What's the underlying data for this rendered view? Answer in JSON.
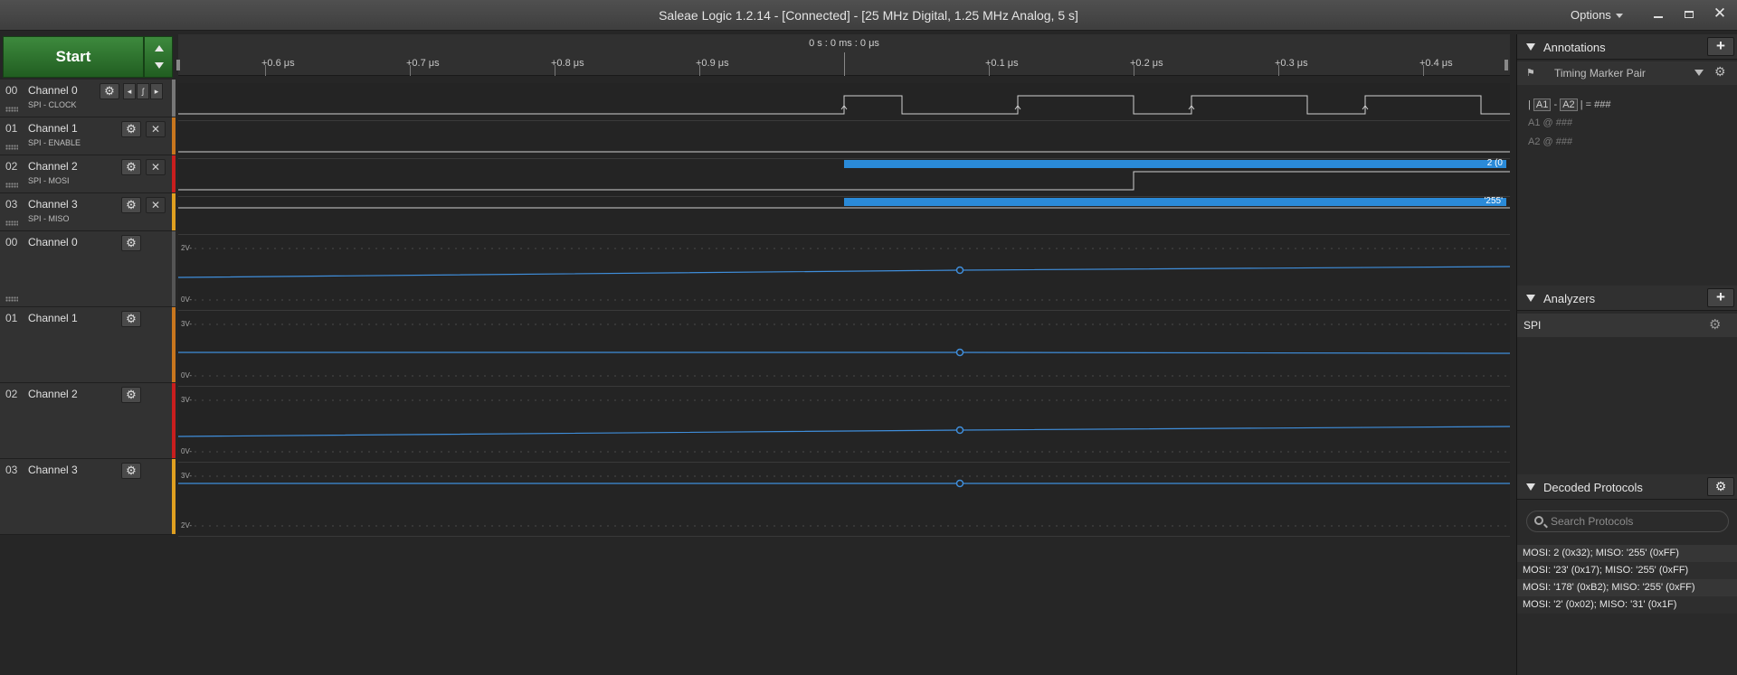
{
  "window": {
    "title": "Saleae Logic 1.2.14 - [Connected] - [25 MHz Digital, 1.25 MHz Analog, 5 s]",
    "options_label": "Options",
    "close_glyph": "✕"
  },
  "toolbar": {
    "start_label": "Start"
  },
  "ruler": {
    "center_time": "0 s : 0 ms : 0 μs",
    "ticks": [
      "+0.6 μs",
      "+0.7 μs",
      "+0.8 μs",
      "+0.9 μs",
      "+0.1 μs",
      "+0.2 μs",
      "+0.3 μs",
      "+0.4 μs"
    ]
  },
  "digital_channels": [
    {
      "num": "00",
      "name": "Channel 0",
      "sub": "SPI - CLOCK",
      "color": "#777777"
    },
    {
      "num": "01",
      "name": "Channel 1",
      "sub": "SPI - ENABLE",
      "color": "#c8761e"
    },
    {
      "num": "02",
      "name": "Channel 2",
      "sub": "SPI - MOSI",
      "color": "#c81e1e"
    },
    {
      "num": "03",
      "name": "Channel 3",
      "sub": "SPI - MISO",
      "color": "#e0a020"
    }
  ],
  "analog_channels": [
    {
      "num": "00",
      "name": "Channel 0",
      "vmax": "2V-",
      "vmin": "0V-",
      "color": "#555555"
    },
    {
      "num": "01",
      "name": "Channel 1",
      "vmax": "3V-",
      "vmin": "0V-",
      "color": "#c8761e"
    },
    {
      "num": "02",
      "name": "Channel 2",
      "vmax": "3V-",
      "vmin": "0V-",
      "color": "#c81e1e"
    },
    {
      "num": "03",
      "name": "Channel 3",
      "vmax": "3V-",
      "vmin": "2V-",
      "color": "#e0a020"
    }
  ],
  "protocol_labels": {
    "mosi": "2 (0",
    "miso": "'255'"
  },
  "annotations": {
    "title": "Annotations",
    "marker_label": "Timing Marker Pair",
    "formula": {
      "a1": "A1",
      "dash": "-",
      "a2": "A2",
      "result": "| = ###"
    },
    "a1_line": "A1  @  ###",
    "a2_line": "A2  @  ###"
  },
  "analyzers": {
    "title": "Analyzers",
    "items": [
      "SPI"
    ]
  },
  "decoded": {
    "title": "Decoded Protocols",
    "search_placeholder": "Search Protocols",
    "rows": [
      "MOSI: 2 (0x32);  MISO: '255' (0xFF)",
      "MOSI: '23' (0x17);  MISO: '255' (0xFF)",
      "MOSI: '178' (0xB2);  MISO: '255' (0xFF)",
      "MOSI: '2' (0x02);  MISO: '31' (0x1F)"
    ]
  },
  "icons": {
    "gear": "gear-icon",
    "add": "plus-icon",
    "close": "close-icon",
    "trigger": "trigger-icon",
    "search": "search-icon",
    "marker": "pin-icon"
  }
}
